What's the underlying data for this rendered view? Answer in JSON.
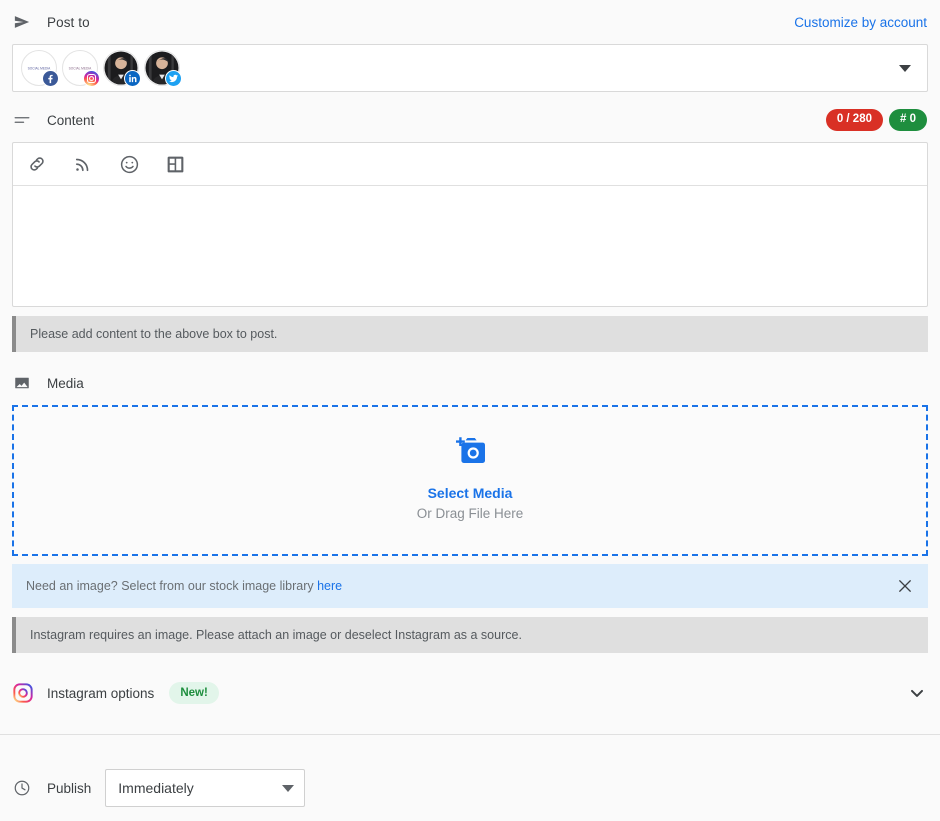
{
  "post_to": {
    "icon": "send-icon",
    "label": "Post to",
    "customize_link": "Customize by account",
    "accounts": [
      {
        "name": "account-facebook",
        "network": "facebook",
        "badge_icon": "facebook-icon",
        "avatar_type": "logo"
      },
      {
        "name": "account-instagram",
        "network": "instagram",
        "badge_icon": "instagram-icon",
        "avatar_type": "logo"
      },
      {
        "name": "account-linkedin",
        "network": "linkedin",
        "badge_icon": "linkedin-icon",
        "avatar_type": "photo"
      },
      {
        "name": "account-twitter",
        "network": "twitter",
        "badge_icon": "twitter-icon",
        "avatar_type": "photo"
      }
    ],
    "dropdown_icon": "caret-down-icon"
  },
  "content": {
    "icon": "content-lines-icon",
    "label": "Content",
    "char_counter": "0 / 280",
    "hashtag_counter": "# 0",
    "toolbar": [
      {
        "name": "insert-link-button",
        "icon": "link-icon"
      },
      {
        "name": "insert-feed-button",
        "icon": "rss-icon"
      },
      {
        "name": "insert-emoji-button",
        "icon": "emoji-icon"
      },
      {
        "name": "insert-template-button",
        "icon": "layout-icon"
      }
    ],
    "editor_value": "",
    "editor_placeholder": "",
    "alert": "Please add content to the above box to post."
  },
  "media": {
    "icon": "image-icon",
    "label": "Media",
    "dropzone_icon": "add-photo-icon",
    "dropzone_primary": "Select Media",
    "dropzone_secondary": "Or Drag File Here",
    "stock_notice_prefix": "Need an image? Select from our stock image library ",
    "stock_notice_link": "here",
    "close_icon": "close-icon",
    "alert": "Instagram requires an image. Please attach an image or deselect Instagram as a source."
  },
  "instagram_options": {
    "icon": "instagram-icon",
    "label": "Instagram options",
    "badge": "New!",
    "expand_icon": "chevron-down-icon"
  },
  "publish": {
    "icon": "clock-icon",
    "label": "Publish",
    "selected": "Immediately",
    "options": [
      "Immediately"
    ],
    "caret_icon": "caret-down-icon"
  },
  "colors": {
    "accent_blue": "#1a73e8",
    "counter_red": "#d93025",
    "counter_green": "#1e8e3e",
    "info_bg": "#ddedfb",
    "alert_bg": "#dfdfdf"
  }
}
